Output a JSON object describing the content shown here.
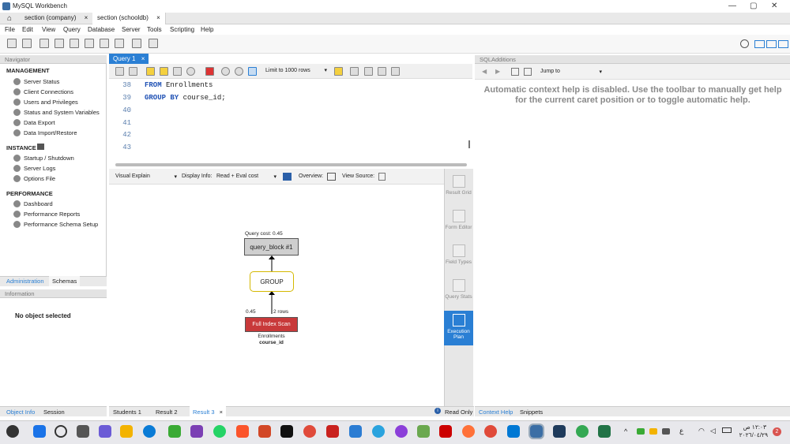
{
  "app": {
    "title": "MySQL Workbench"
  },
  "connection_tabs": [
    {
      "label": "section  (company)",
      "close": "×"
    },
    {
      "label": "section  (schooldb)",
      "close": "×"
    }
  ],
  "menu": [
    "File",
    "Edit",
    "View",
    "Query",
    "Database",
    "Server",
    "Tools",
    "Scripting",
    "Help"
  ],
  "navigator": {
    "header": "Navigator",
    "management_title": "MANAGEMENT",
    "management": [
      "Server Status",
      "Client Connections",
      "Users and Privileges",
      "Status and System Variables",
      "Data Export",
      "Data Import/Restore"
    ],
    "instance_title": "INSTANCE",
    "instance": [
      "Startup / Shutdown",
      "Server Logs",
      "Options File"
    ],
    "performance_title": "PERFORMANCE",
    "performance": [
      "Dashboard",
      "Performance Reports",
      "Performance Schema Setup"
    ],
    "tabs": [
      "Administration",
      "Schemas"
    ],
    "info_header": "Information",
    "info_text": "No object selected",
    "bottom_tabs": [
      "Object Info",
      "Session"
    ]
  },
  "editor": {
    "tab_label": "Query 1",
    "tab_close": "×",
    "limit_label": "Limit to 1000 rows",
    "lines": [
      {
        "no": "38",
        "kw": "FROM",
        "text": " Enrollments"
      },
      {
        "no": "39",
        "kw": "GROUP BY",
        "text": " course_id;"
      },
      {
        "no": "40",
        "kw": "",
        "text": ""
      },
      {
        "no": "41",
        "kw": "",
        "text": ""
      },
      {
        "no": "42",
        "kw": "",
        "text": ""
      },
      {
        "no": "43",
        "kw": "",
        "text": ""
      }
    ]
  },
  "explain": {
    "view_select": "Visual Explain",
    "display_info_label": "Display Info:",
    "display_info_value": "Read + Eval cost",
    "overview_label": "Overview:",
    "view_source_label": "View Source:",
    "query_cost": "Query cost: 0.45",
    "query_block": "query_block #1",
    "group": "GROUP",
    "cost": "0.45",
    "rows": "2 rows",
    "scan": "Full Index Scan",
    "table": "Enrollments",
    "key": "course_id"
  },
  "side_panel": [
    {
      "label": "Result Grid"
    },
    {
      "label": "Form Editor"
    },
    {
      "label": "Field Types"
    },
    {
      "label": "Query Stats"
    },
    {
      "label": "Execution Plan"
    }
  ],
  "result_tabs": [
    {
      "label": "Students 1"
    },
    {
      "label": "Result 2"
    },
    {
      "label": "Result 3",
      "close": "×"
    }
  ],
  "status": {
    "read_only": "Read Only"
  },
  "sql_additions": {
    "header": "SQLAdditions",
    "jump_to": "Jump to",
    "help_text": "Automatic context help is disabled. Use the toolbar to manually get help for the current caret position or to toggle automatic help.",
    "bottom_tabs": [
      "Context Help",
      "Snippets"
    ]
  },
  "taskbar": {
    "time": "١٢:٠٣ ص",
    "date": "٢٠٢٦/٠٤/٢٩",
    "lang": "ع",
    "notif_count": "2"
  },
  "colors": {
    "accent": "#2a7fd4",
    "scan_red": "#c8393a",
    "group_yellow": "#d4b800",
    "keyword": "#1e50b4"
  }
}
